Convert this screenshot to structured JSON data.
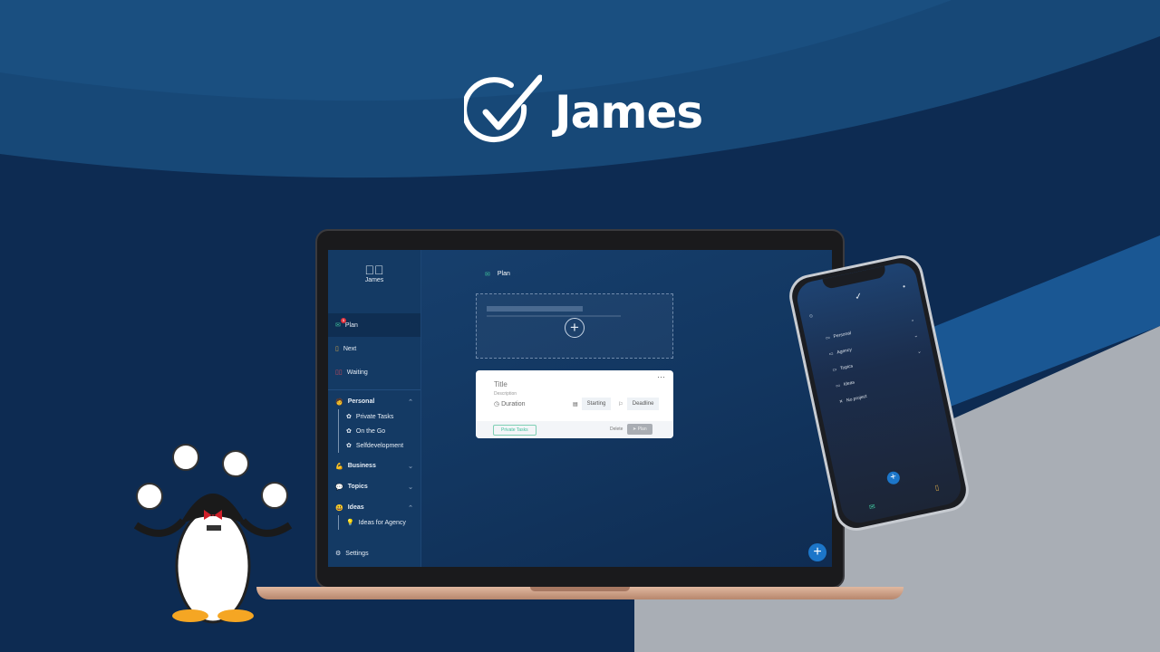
{
  "brand": {
    "name": "James",
    "logo_icon": "check-circle-icon"
  },
  "laptop_app": {
    "sidebar": {
      "brand": "James",
      "items": [
        {
          "label": "Plan",
          "icon": "inbox-icon",
          "badge": "1",
          "active": true
        },
        {
          "label": "Next",
          "icon": "clipboard-icon"
        },
        {
          "label": "Waiting",
          "icon": "pause-icon"
        }
      ],
      "groups": [
        {
          "label": "Personal",
          "icon": "face-icon",
          "expanded": true,
          "children": [
            "Private Tasks",
            "On the Go",
            "Selfdevelopment"
          ]
        },
        {
          "label": "Business",
          "icon": "muscle-icon",
          "expanded": false,
          "children": []
        },
        {
          "label": "Topics",
          "icon": "speech-bubble-icon",
          "expanded": false,
          "children": []
        },
        {
          "label": "Ideas",
          "icon": "smiley-icon",
          "expanded": true,
          "children": [
            "Ideas for Agency"
          ]
        }
      ],
      "settings": "Settings"
    },
    "main": {
      "header": "Plan",
      "card": {
        "title": "Title",
        "description": "Description",
        "duration": "Duration",
        "starting": "Starting",
        "deadline": "Deadline",
        "project": "Private Tasks",
        "delete": "Delete",
        "plan": "Plan",
        "more": "···"
      }
    }
  },
  "phone_app": {
    "projects": [
      "Personal",
      "Agency",
      "Topics",
      "Ideas"
    ],
    "no_project": "No project"
  },
  "colors": {
    "background": "#0d2b52",
    "accent": "#1c76c9",
    "plan_green": "#3fbf9a"
  }
}
